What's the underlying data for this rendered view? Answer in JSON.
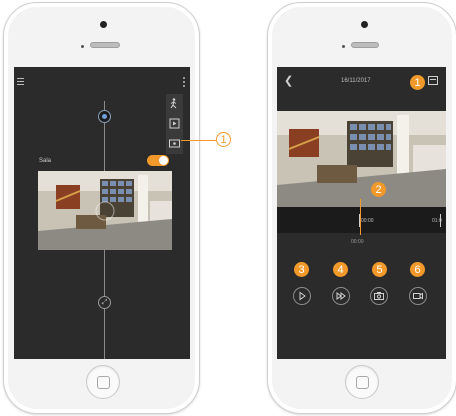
{
  "colors": {
    "accent": "#f19a2b",
    "screen_bg": "#2b2b2b",
    "phone_body": "#f3f3f3"
  },
  "left_screen": {
    "menu_icon": "hamburger-icon",
    "more_icon": "kebab-icon",
    "camera_name": "Sala",
    "camera_toggle_on": true,
    "side_tools": [
      "motion-icon",
      "play-icon",
      "screen-icon"
    ]
  },
  "right_screen": {
    "date": "16/11/2017",
    "current_time": "00:00",
    "timeline_labels": [
      "00:00",
      "01:0"
    ],
    "controls": [
      "play-icon",
      "fast-forward-icon",
      "snapshot-icon",
      "record-icon"
    ]
  },
  "callouts": {
    "left_tool": "1",
    "calendar": "1",
    "scrubber": "2",
    "play": "3",
    "fast_forward": "4",
    "snapshot": "5",
    "record": "6"
  }
}
